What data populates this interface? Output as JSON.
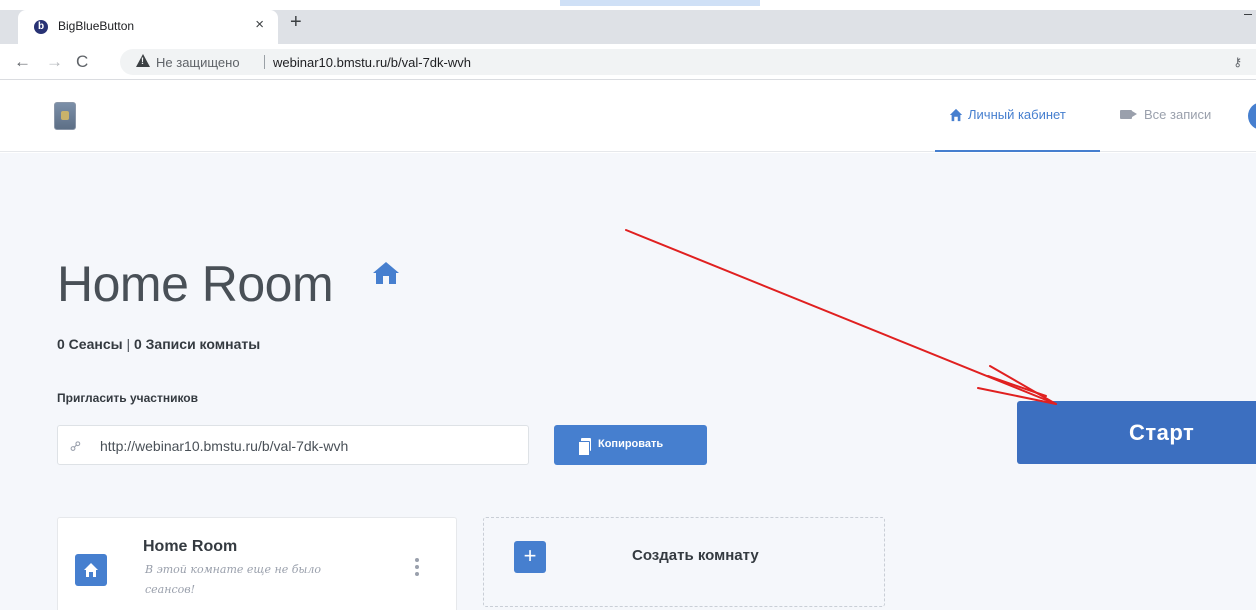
{
  "browser": {
    "tab_title": "BigBlueButton",
    "tab_favicon": "b",
    "tab_close": "×",
    "new_tab": "+",
    "security_text": "Не защищено",
    "url": "webinar10.bmstu.ru/b/val-7dk-wvh",
    "icons": [
      "back-arrow-icon",
      "forward-arrow-icon",
      "reload-icon",
      "warning-icon",
      "key-icon"
    ]
  },
  "header": {
    "nav": [
      {
        "label": "Личный кабинет",
        "icon": "home-icon",
        "active": true
      },
      {
        "label": "Все записи",
        "icon": "video-camera-icon",
        "active": false
      }
    ]
  },
  "room": {
    "title": "Home Room",
    "stats_sessions": "0 Сеансы",
    "stats_separator": "|",
    "stats_recordings": "0 Записи комнаты",
    "invite_label": "Пригласить участников",
    "invite_url": "http://webinar10.bmstu.ru/b/val-7dk-wvh",
    "copy_button": "Копировать",
    "start_button": "Старт"
  },
  "room_card": {
    "title": "Home Room",
    "subtitle": "В этой комнате еще не было сеансов!"
  },
  "create_room": {
    "plus": "+",
    "label": "Создать комнату"
  },
  "colors": {
    "primary": "#467fcf",
    "start_button": "#3c6fc0",
    "annotation_arrow": "#e02020",
    "background": "#f5f7fb"
  }
}
